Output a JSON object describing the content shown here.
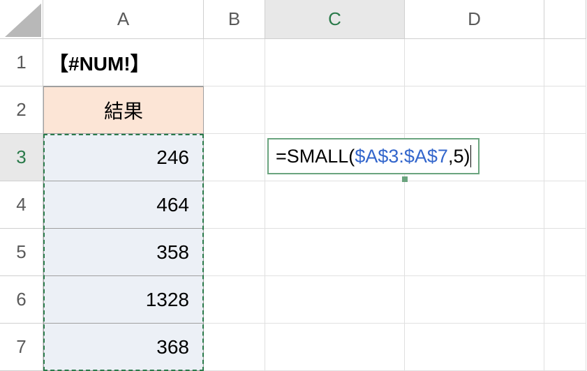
{
  "columns": [
    "A",
    "B",
    "C",
    "D"
  ],
  "rows": [
    "1",
    "2",
    "3",
    "4",
    "5",
    "6",
    "7"
  ],
  "cells": {
    "a1": "【#NUM!】",
    "a2": "結果",
    "a3": "246",
    "a4": "464",
    "a5": "358",
    "a6": "1328",
    "a7": "368"
  },
  "formula": {
    "prefix": "=SMALL(",
    "ref": "$A$3:$A$7",
    "suffix": ",5)"
  },
  "active_column_index": 2,
  "active_row_index": 2,
  "chart_data": {
    "type": "table",
    "title": "【#NUM!】",
    "columns": [
      "結果"
    ],
    "values": [
      246,
      464,
      358,
      1328,
      368
    ],
    "formula": "=SMALL($A$3:$A$7,5)"
  }
}
